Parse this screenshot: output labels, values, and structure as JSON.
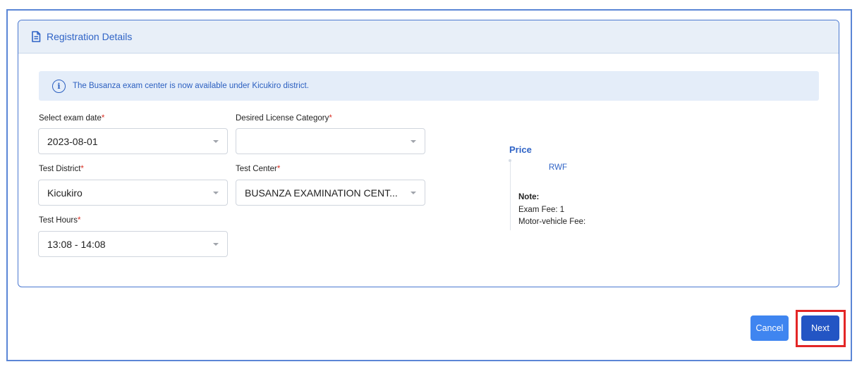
{
  "card": {
    "title": "Registration Details",
    "icon": "document-icon"
  },
  "alert": {
    "icon": "info-icon",
    "text": "The Busanza exam center is now available under Kicukiro district."
  },
  "form": {
    "exam_date": {
      "label": "Select exam date",
      "required": "*",
      "value": "2023-08-01"
    },
    "license_category": {
      "label": "Desired License Category",
      "required": "*",
      "value": ""
    },
    "test_district": {
      "label": "Test District",
      "required": "*",
      "value": "Kicukiro"
    },
    "test_center": {
      "label": "Test Center",
      "required": "*",
      "value": "BUSANZA EXAMINATION CENT..."
    },
    "test_hours": {
      "label": "Test Hours",
      "required": "*",
      "value": "13:08 - 14:08"
    }
  },
  "price": {
    "title": "Price",
    "currency": "RWF",
    "note_title": "Note:",
    "exam_fee": "Exam Fee: 1",
    "motor_vehicle_fee": "Motor-vehicle Fee:"
  },
  "actions": {
    "cancel_label": "Cancel",
    "next_label": "Next"
  },
  "colors": {
    "accent": "#2f63c6",
    "primary_button": "#2355c4",
    "secondary_button": "#3f85f0",
    "required": "#d93025",
    "highlight": "#e32626"
  }
}
